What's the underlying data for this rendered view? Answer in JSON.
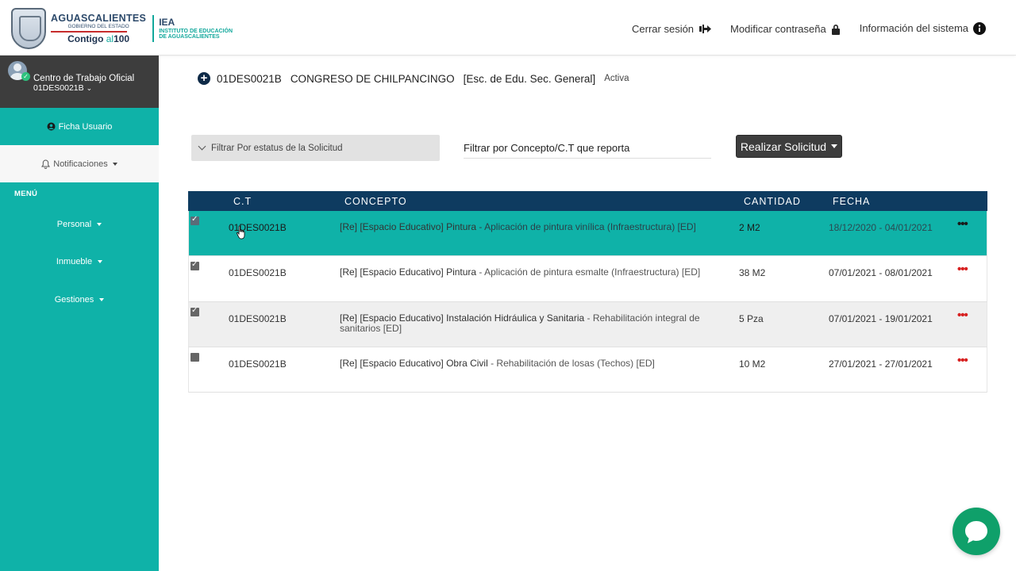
{
  "header": {
    "logo": {
      "state": "AGUASCALIENTES",
      "gov": "GOBIERNO DEL ESTADO",
      "contigo_a": "Contigo ",
      "contigo_al": "al",
      "contigo_b": "100",
      "iea": "IEA",
      "iea_sub1": "INSTITUTO DE EDUCACIÓN",
      "iea_sub2": "DE AGUASCALIENTES"
    },
    "actions": {
      "logout": "Cerrar sesión",
      "change_password": "Modificar contraseña",
      "system_info": "Información del sistema"
    }
  },
  "sidebar": {
    "user_title": "Centro de Trabajo Oficial",
    "user_code": "01DES0021B",
    "ficha": "Ficha Usuario",
    "notifications": "Notificaciones",
    "menu_label": "MENÚ",
    "items": [
      {
        "label": "Personal"
      },
      {
        "label": "Inmueble"
      },
      {
        "label": "Gestiones"
      }
    ]
  },
  "school": {
    "code": "01DES0021B",
    "name": "CONGRESO DE CHILPANCINGO",
    "type": "[Esc. de Edu. Sec. General]",
    "status": "Activa"
  },
  "filters": {
    "status_label": "Filtrar Por estatus de la Solicitud",
    "concept_placeholder": "Filtrar por Concepto/C.T que reporta",
    "realizar_label": "Realizar Solicitud"
  },
  "table": {
    "headers": {
      "ct": "C.T",
      "concept": "CONCEPTO",
      "qty": "CANTIDAD",
      "date": "FECHA"
    },
    "rows": [
      {
        "ct": "01DES0021B",
        "concept": "[Re] [Espacio Educativo] Pintura",
        "desc": " - Aplicación de pintura vinílica (Infraestructura) [ED]",
        "qty": "2 M2",
        "date": "18/12/2020 - 04/01/2021",
        "dots": "•••"
      },
      {
        "ct": "01DES0021B",
        "concept": "[Re] [Espacio Educativo] Pintura",
        "desc": " - Aplicación de pintura esmalte (Infraestructura) [ED]",
        "qty": "38 M2",
        "date": "07/01/2021 - 08/01/2021",
        "dots": "•••"
      },
      {
        "ct": "01DES0021B",
        "concept": "[Re] [Espacio Educativo] Instalación Hidráulica y Sanitaria",
        "desc": " - Rehabilitación integral de sanitarios [ED]",
        "qty": "5 Pza",
        "date": "07/01/2021 - 19/01/2021",
        "dots": "•••"
      },
      {
        "ct": "01DES0021B",
        "concept": "[Re] [Espacio Educativo] Obra Civil",
        "desc": " - Rehabilitación de losas (Techos) [ED]",
        "qty": "10 M2",
        "date": "27/01/2021 - 27/01/2021",
        "dots": "•••"
      }
    ]
  },
  "colors": {
    "teal": "#0fb2a8",
    "navy": "#0e3b60",
    "dark": "#3d3d3d",
    "dots_red": "#d72020",
    "chat_green": "#0fa06a"
  }
}
